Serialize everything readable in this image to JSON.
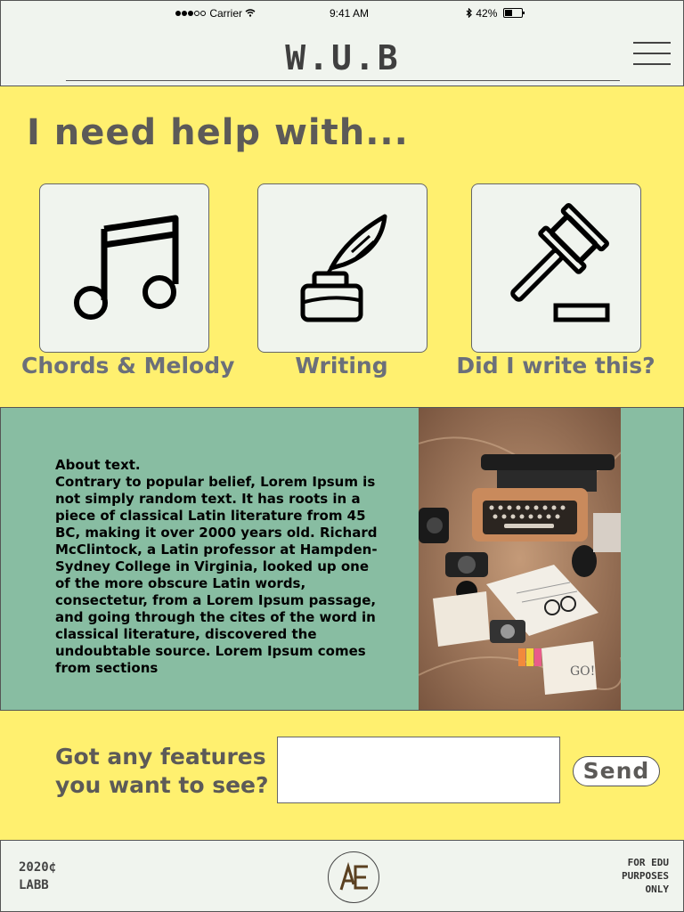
{
  "status_bar": {
    "carrier": "Carrier",
    "time": "9:41 AM",
    "battery": "42%",
    "battery_level": 0.42
  },
  "header": {
    "brand": "W.U.B",
    "menu_icon": "hamburger-menu-icon"
  },
  "hero": {
    "title": "I need help with...",
    "cards": [
      {
        "label": "Chords & Melody",
        "icon": "music-notes-icon"
      },
      {
        "label": "Writing",
        "icon": "quill-inkwell-icon"
      },
      {
        "label": "Did I write this?",
        "icon": "gavel-icon"
      }
    ]
  },
  "about": {
    "heading": "About text.",
    "body": "Contrary to popular belief, Lorem Ipsum is not simply random text. It has roots in a piece of classical Latin literature from 45 BC, making it over 2000 years old. Richard McClintock, a Latin professor at Hampden-Sydney College in Virginia, looked up one of the more obscure Latin words, consectetur, from a Lorem Ipsum passage, and going through the cites of the word in classical literature, discovered the undoubtable source. Lorem Ipsum comes from sections",
    "image": "typewriter-desk-photo"
  },
  "feature": {
    "question_line1": "Got any features",
    "question_line2": "you want to see?",
    "input_value": "",
    "send_label": "Send"
  },
  "footer": {
    "year": "2020¢",
    "org": "LABB",
    "note_line1": "FOR EDU",
    "note_line2": "PURPOSES",
    "note_line3": "ONLY",
    "logo_text": "AE"
  },
  "colors": {
    "page_bg": "#fff06f",
    "panel_bg": "#f0f4ee",
    "about_bg": "#88bda2",
    "heading_text": "#5c5a58",
    "card_label": "#6b6f7a"
  }
}
